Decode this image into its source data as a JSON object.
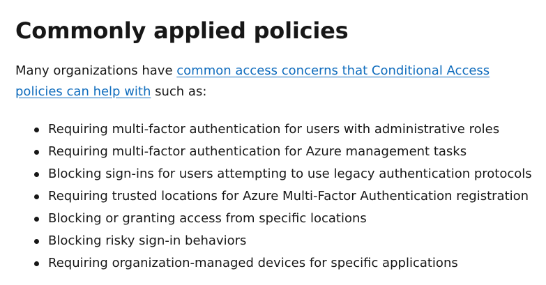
{
  "heading": "Commonly applied policies",
  "intro": {
    "prefix": "Many organizations have ",
    "link_text": "common access concerns that Conditional Access policies can help with",
    "suffix": " such as:"
  },
  "policies": [
    "Requiring multi-factor authentication for users with administrative roles",
    "Requiring multi-factor authentication for Azure management tasks",
    "Blocking sign-ins for users attempting to use legacy authentication protocols",
    "Requiring trusted locations for Azure Multi-Factor Authentication registration",
    "Blocking or granting access from specific locations",
    "Blocking risky sign-in behaviors",
    "Requiring organization-managed devices for specific applications"
  ],
  "colors": {
    "text": "#171717",
    "link": "#0f6cbd",
    "background": "#ffffff"
  }
}
